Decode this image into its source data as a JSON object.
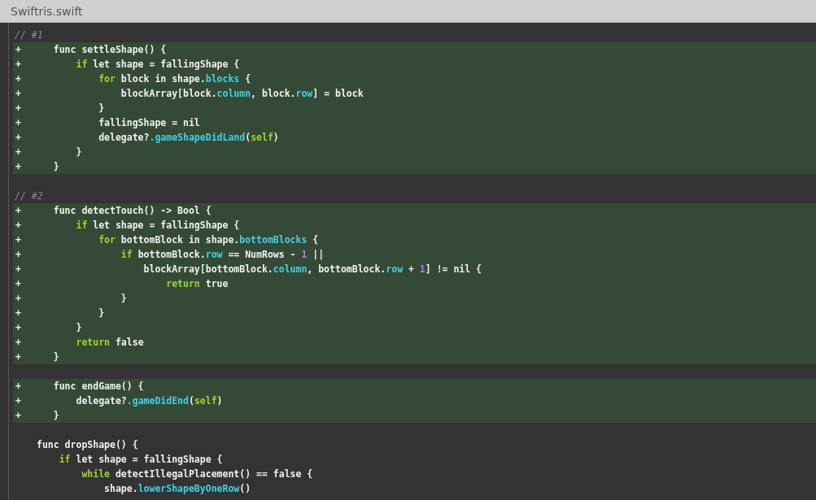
{
  "file_title": "Swiftris.swift",
  "lines": [
    {
      "kind": "comment",
      "code": [
        {
          "text": "// #1",
          "kind": "comment"
        }
      ]
    },
    {
      "kind": "added",
      "marker": "+",
      "code": [
        {
          "text": "   func settleShape() {",
          "kind": "plain"
        }
      ]
    },
    {
      "kind": "added",
      "marker": "+",
      "code": [
        {
          "text": "       if",
          "kind": "keyword"
        },
        {
          "text": " let shape = fallingShape {",
          "kind": "plain"
        }
      ]
    },
    {
      "kind": "added",
      "marker": "+",
      "code": [
        {
          "text": "           for",
          "kind": "keyword"
        },
        {
          "text": " block in shape.",
          "kind": "plain"
        },
        {
          "text": "blocks",
          "kind": "member"
        },
        {
          "text": " {",
          "kind": "plain"
        }
      ]
    },
    {
      "kind": "added",
      "marker": "+",
      "code": [
        {
          "text": "               blockArray[block.",
          "kind": "plain"
        },
        {
          "text": "column",
          "kind": "member"
        },
        {
          "text": ", block.",
          "kind": "plain"
        },
        {
          "text": "row",
          "kind": "member"
        },
        {
          "text": "] = block",
          "kind": "plain"
        }
      ]
    },
    {
      "kind": "added",
      "marker": "+",
      "code": [
        {
          "text": "           }",
          "kind": "plain"
        }
      ]
    },
    {
      "kind": "added",
      "marker": "+",
      "code": [
        {
          "text": "           fallingShape = nil",
          "kind": "plain"
        }
      ]
    },
    {
      "kind": "added",
      "marker": "+",
      "code": [
        {
          "text": "           delegate?",
          "kind": "plain"
        },
        {
          "text": ".gameShapeDidLand",
          "kind": "member"
        },
        {
          "text": "(",
          "kind": "plain"
        },
        {
          "text": "self",
          "kind": "keyword"
        },
        {
          "text": ")",
          "kind": "plain"
        }
      ]
    },
    {
      "kind": "added",
      "marker": "+",
      "code": [
        {
          "text": "       }",
          "kind": "plain"
        }
      ]
    },
    {
      "kind": "added",
      "marker": "+",
      "code": [
        {
          "text": "   }",
          "kind": "plain"
        }
      ]
    },
    {
      "kind": "blank"
    },
    {
      "kind": "comment",
      "code": [
        {
          "text": "// #2",
          "kind": "comment"
        }
      ]
    },
    {
      "kind": "added",
      "marker": "+",
      "code": [
        {
          "text": "   func detectTouch() -> Bool {",
          "kind": "plain"
        }
      ]
    },
    {
      "kind": "added",
      "marker": "+",
      "code": [
        {
          "text": "       if",
          "kind": "keyword"
        },
        {
          "text": " let shape = fallingShape {",
          "kind": "plain"
        }
      ]
    },
    {
      "kind": "added",
      "marker": "+",
      "code": [
        {
          "text": "           for",
          "kind": "keyword"
        },
        {
          "text": " bottomBlock in shape.",
          "kind": "plain"
        },
        {
          "text": "bottomBlocks",
          "kind": "member"
        },
        {
          "text": " {",
          "kind": "plain"
        }
      ]
    },
    {
      "kind": "added",
      "marker": "+",
      "code": [
        {
          "text": "               if",
          "kind": "keyword"
        },
        {
          "text": " bottomBlock.",
          "kind": "plain"
        },
        {
          "text": "row",
          "kind": "member"
        },
        {
          "text": " == NumRows - ",
          "kind": "plain"
        },
        {
          "text": "1",
          "kind": "number"
        },
        {
          "text": " ||",
          "kind": "plain"
        }
      ]
    },
    {
      "kind": "added",
      "marker": "+",
      "code": [
        {
          "text": "                   blockArray[bottomBlock.",
          "kind": "plain"
        },
        {
          "text": "column",
          "kind": "member"
        },
        {
          "text": ", bottomBlock.",
          "kind": "plain"
        },
        {
          "text": "row",
          "kind": "member"
        },
        {
          "text": " + ",
          "kind": "plain"
        },
        {
          "text": "1",
          "kind": "number"
        },
        {
          "text": "] != nil {",
          "kind": "plain"
        }
      ]
    },
    {
      "kind": "added",
      "marker": "+",
      "code": [
        {
          "text": "                       return",
          "kind": "keyword"
        },
        {
          "text": " true",
          "kind": "plain"
        }
      ]
    },
    {
      "kind": "added",
      "marker": "+",
      "code": [
        {
          "text": "               }",
          "kind": "plain"
        }
      ]
    },
    {
      "kind": "added",
      "marker": "+",
      "code": [
        {
          "text": "           }",
          "kind": "plain"
        }
      ]
    },
    {
      "kind": "added",
      "marker": "+",
      "code": [
        {
          "text": "       }",
          "kind": "plain"
        }
      ]
    },
    {
      "kind": "added",
      "marker": "+",
      "code": [
        {
          "text": "       return",
          "kind": "keyword"
        },
        {
          "text": " false",
          "kind": "plain"
        }
      ]
    },
    {
      "kind": "added",
      "marker": "+",
      "code": [
        {
          "text": "   }",
          "kind": "plain"
        }
      ]
    },
    {
      "kind": "blank"
    },
    {
      "kind": "added",
      "marker": "+",
      "code": [
        {
          "text": "   func endGame() {",
          "kind": "plain"
        }
      ]
    },
    {
      "kind": "added",
      "marker": "+",
      "code": [
        {
          "text": "       delegate?",
          "kind": "plain"
        },
        {
          "text": ".gameDidEnd",
          "kind": "member"
        },
        {
          "text": "(",
          "kind": "plain"
        },
        {
          "text": "self",
          "kind": "keyword"
        },
        {
          "text": ")",
          "kind": "plain"
        }
      ]
    },
    {
      "kind": "added",
      "marker": "+",
      "code": [
        {
          "text": "   }",
          "kind": "plain"
        }
      ]
    },
    {
      "kind": "blank"
    },
    {
      "kind": "context",
      "code": [
        {
          "text": "func dropShape() {",
          "kind": "plain"
        }
      ]
    },
    {
      "kind": "context",
      "code": [
        {
          "text": "    if",
          "kind": "keyword"
        },
        {
          "text": " let shape = fallingShape {",
          "kind": "plain"
        }
      ]
    },
    {
      "kind": "context",
      "code": [
        {
          "text": "        while",
          "kind": "keyword"
        },
        {
          "text": " detectIllegalPlacement() == false {",
          "kind": "plain"
        }
      ]
    },
    {
      "kind": "context",
      "code": [
        {
          "text": "            shape.",
          "kind": "plain"
        },
        {
          "text": "lowerShapeByOneRow",
          "kind": "member"
        },
        {
          "text": "()",
          "kind": "plain"
        }
      ]
    }
  ]
}
